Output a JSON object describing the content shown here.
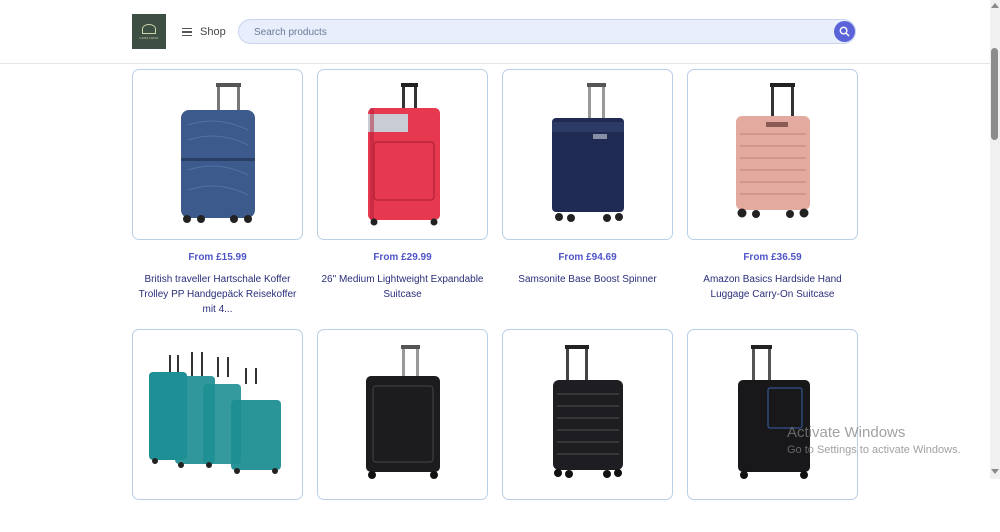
{
  "header": {
    "logo_text": "CASA NOVA",
    "shop_label": "Shop",
    "search_placeholder": "Search products"
  },
  "products": [
    {
      "price": "From £15.99",
      "name": "British traveller Hartschale Koffer Trolley PP Handgepäck Reisekoffer mit 4...",
      "color": "#3d5a8c",
      "icon": "hardshell-suitcase-blue"
    },
    {
      "price": "From £29.99",
      "name": "26\" Medium Lightweight Expandable Suitcase",
      "color": "#e63950",
      "icon": "soft-suitcase-red"
    },
    {
      "price": "From £94.69",
      "name": "Samsonite Base Boost Spinner",
      "color": "#1f2b52",
      "icon": "soft-suitcase-navy"
    },
    {
      "price": "From £36.59",
      "name": "Amazon Basics Hardside Hand Luggage Carry-On Suitcase",
      "color": "#e3aaa0",
      "icon": "hardshell-suitcase-rose"
    },
    {
      "price": "",
      "name": "",
      "color": "#1e8f94",
      "icon": "suitcase-set-teal"
    },
    {
      "price": "",
      "name": "",
      "color": "#1c1c1e",
      "icon": "soft-suitcase-black"
    },
    {
      "price": "",
      "name": "",
      "color": "#1e1e22",
      "icon": "hardshell-suitcase-black"
    },
    {
      "price": "",
      "name": "",
      "color": "#18181b",
      "icon": "soft-suitcase-black-2"
    }
  ],
  "watermark": {
    "line1": "Activate Windows",
    "line2": "Go to Settings to activate Windows."
  }
}
